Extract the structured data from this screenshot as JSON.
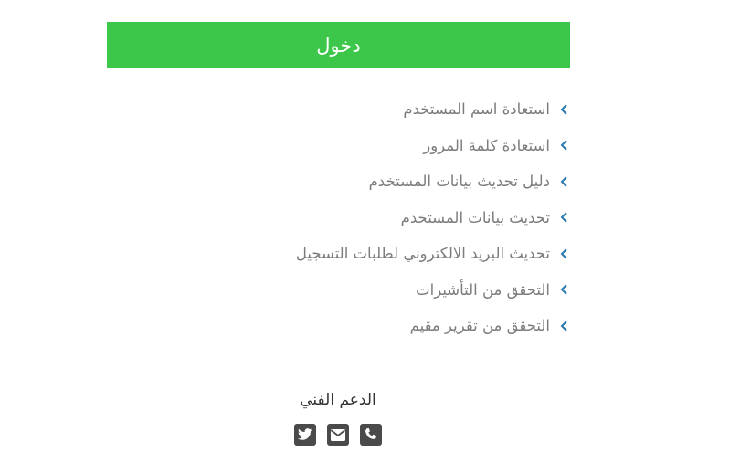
{
  "login": {
    "label": "دخول",
    "color": "#3cc64a"
  },
  "links": [
    {
      "label": "استعادة اسم المستخدم"
    },
    {
      "label": "استعادة كلمة المرور"
    },
    {
      "label": "دليل تحديث بيانات المستخدم"
    },
    {
      "label": "تحديث بيانات المستخدم"
    },
    {
      "label": "تحديث البريد الالكتروني لطلبات التسجيل"
    },
    {
      "label": "التحقق من التأشيرات"
    },
    {
      "label": "التحقق من تقرير مقيم"
    }
  ],
  "link_icon": "chevron-left-icon",
  "link_icon_color": "#2a7ab0",
  "support": {
    "title": "الدعم الفني",
    "icons": [
      "twitter-icon",
      "envelope-icon",
      "phone-icon"
    ]
  }
}
